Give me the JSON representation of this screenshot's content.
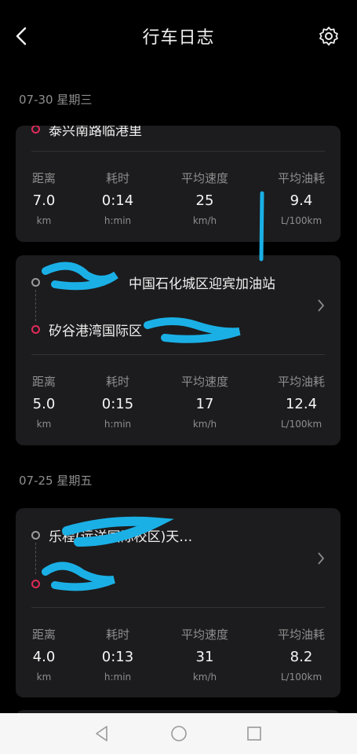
{
  "header": {
    "title": "行车日志"
  },
  "sections": [
    {
      "date": "07-30 星期三",
      "trips": [
        {
          "end": "泰兴南路临港里",
          "stats": [
            {
              "label": "距离",
              "value": "7.0",
              "unit": "km"
            },
            {
              "label": "耗时",
              "value": "0:14",
              "unit": "h:min"
            },
            {
              "label": "平均速度",
              "value": "25",
              "unit": "km/h"
            },
            {
              "label": "平均油耗",
              "value": "9.4",
              "unit": "L/100km"
            }
          ]
        },
        {
          "start": "中国石化城区迎宾加油站",
          "end": "矽谷港湾国际区",
          "stats": [
            {
              "label": "距离",
              "value": "5.0",
              "unit": "km"
            },
            {
              "label": "耗时",
              "value": "0:15",
              "unit": "h:min"
            },
            {
              "label": "平均速度",
              "value": "17",
              "unit": "km/h"
            },
            {
              "label": "平均油耗",
              "value": "12.4",
              "unit": "L/100km"
            }
          ]
        }
      ]
    },
    {
      "date": "07-25 星期五",
      "trips": [
        {
          "start": "乐程(远洋国际校区)天…",
          "end": "",
          "stats": [
            {
              "label": "距离",
              "value": "4.0",
              "unit": "km"
            },
            {
              "label": "耗时",
              "value": "0:13",
              "unit": "h:min"
            },
            {
              "label": "平均速度",
              "value": "31",
              "unit": "km/h"
            },
            {
              "label": "平均油耗",
              "value": "8.2",
              "unit": "L/100km"
            }
          ]
        }
      ]
    }
  ],
  "colors": {
    "end_dot": "#e02a5a",
    "start_dot": "#9a9a9a",
    "annotation": "#1ab0e6"
  },
  "icons": [
    "back-arrow-icon",
    "gear-icon",
    "chevron-right-icon",
    "nav-back-icon",
    "nav-home-icon",
    "nav-recents-icon"
  ]
}
